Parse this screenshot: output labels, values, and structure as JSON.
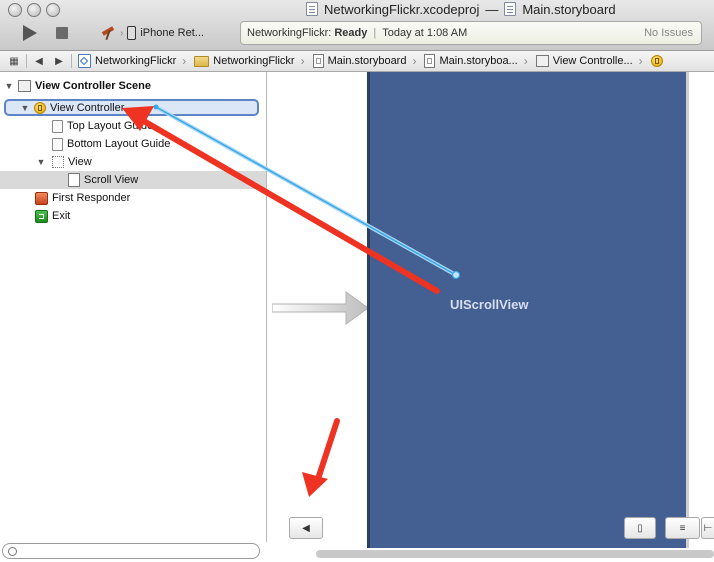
{
  "window": {
    "project_file": "NetworkingFlickr.xcodeproj",
    "separator": "—",
    "document": "Main.storyboard"
  },
  "toolbar": {
    "run_icon": "play-icon",
    "stop_icon": "stop-icon",
    "scheme_target": "iPhone Ret...",
    "activity": {
      "status_prefix": "NetworkingFlickr:",
      "status_value": "Ready",
      "separator": "|",
      "time": "Today at 1:08 AM",
      "issues": "No Issues"
    }
  },
  "jumpbar": {
    "back_glyph": "◀",
    "forward_glyph": "▶",
    "crumbs": [
      {
        "label": "NetworkingFlickr",
        "icon": "xcodeproj-icon"
      },
      {
        "label": "NetworkingFlickr",
        "icon": "folder-icon"
      },
      {
        "label": "Main.storyboard",
        "icon": "storyboard-icon"
      },
      {
        "label": "Main.storyboa...",
        "icon": "storyboard-icon"
      },
      {
        "label": "View Controlle...",
        "icon": "scene-icon"
      },
      {
        "label": "",
        "icon": "view-controller-icon"
      }
    ]
  },
  "outline": {
    "scene_title": "View Controller Scene",
    "items": [
      {
        "label": "View Controller",
        "icon": "view-controller-icon"
      },
      {
        "label": "Top Layout Guide",
        "icon": "layout-guide-icon"
      },
      {
        "label": "Bottom Layout Guide",
        "icon": "layout-guide-icon"
      },
      {
        "label": "View",
        "icon": "view-icon"
      },
      {
        "label": "Scroll View",
        "icon": "scroll-view-icon"
      },
      {
        "label": "First Responder",
        "icon": "first-responder-icon"
      },
      {
        "label": "Exit",
        "icon": "exit-icon"
      }
    ]
  },
  "canvas": {
    "scroll_view_label": "UIScrollView",
    "bottom_buttons": [
      "◀",
      "▯",
      "≡",
      "⊢"
    ]
  },
  "colors": {
    "scene_blue": "#445f91",
    "annotation_red": "#ee3322",
    "connection_line": "#3aa7e6",
    "selection_border": "#5b85c7"
  }
}
